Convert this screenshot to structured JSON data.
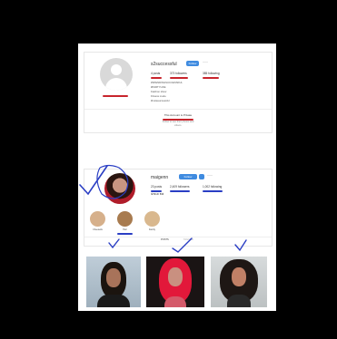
{
  "card1": {
    "username": "s2successful",
    "follow_label": "Follow",
    "more_label": "···",
    "stats": {
      "posts": "4 posts",
      "followers": "373 followers",
      "following": "385 following"
    },
    "bio_lines": [
      "#SPENDINGSUCCESSFUL",
      "#PARTYLIFE",
      "Fashion show",
      "Fitness mode",
      "#instasuccessful"
    ],
    "private_title": "This Account is Private",
    "private_line1": "Follow to see their photos and",
    "private_line2": "videos."
  },
  "card2": {
    "username": "maigenn",
    "follow_label": "Follow",
    "more_label": "···",
    "stats": {
      "posts": "23 posts",
      "followers": "2,409 followers",
      "following": "1,002 following"
    },
    "bio": "♛BAD B♛",
    "highlights": [
      "Cheeseits",
      "Hair",
      "Family"
    ],
    "tabs": [
      "POSTS",
      "TAGGED"
    ]
  },
  "colors": {
    "follow_button": "#3f8be0",
    "pen_red": "#c8242c",
    "pen_blue": "#2a3ec4"
  },
  "icons": [
    "default-avatar-icon",
    "grid-icon",
    "tag-icon"
  ]
}
